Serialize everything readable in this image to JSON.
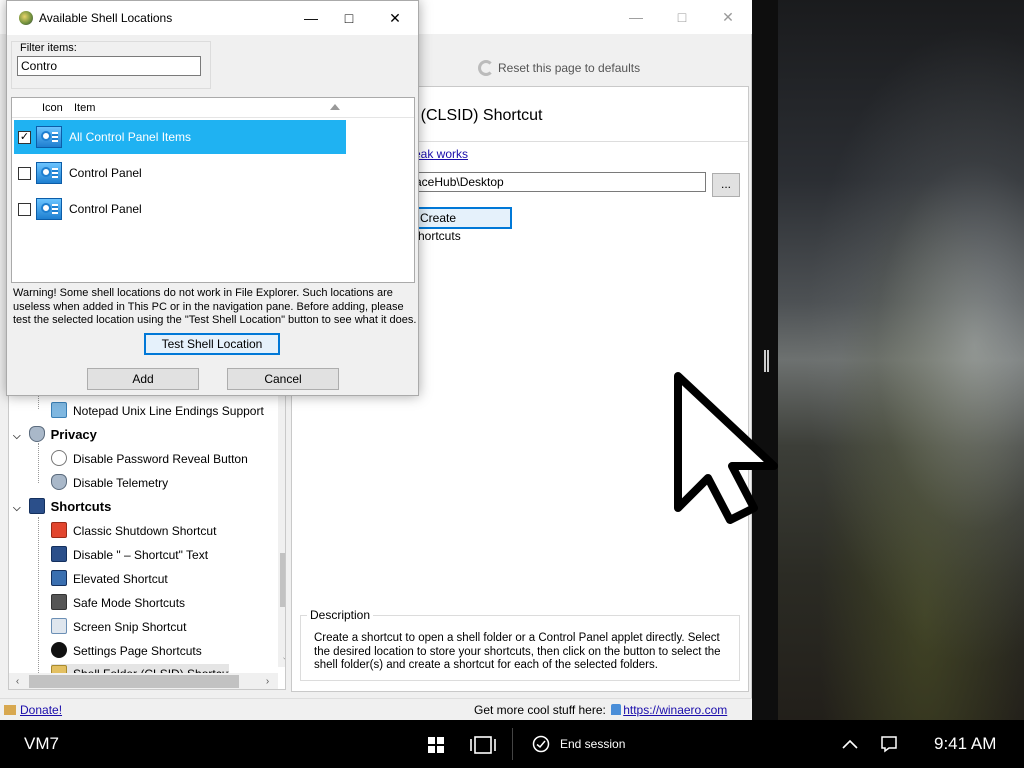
{
  "dialog": {
    "title": "Available Shell Locations",
    "filter_label": "Filter items:",
    "filter_value": "Contro",
    "columns": {
      "icon": "Icon",
      "item": "Item"
    },
    "items": [
      {
        "label": "All Control Panel Items",
        "checked": true,
        "selected": true
      },
      {
        "label": "Control Panel",
        "checked": false,
        "selected": false
      },
      {
        "label": "Control Panel",
        "checked": false,
        "selected": false
      }
    ],
    "warning": "Warning! Some shell locations do not work in File Explorer. Such locations are useless when added in This PC or in the navigation pane. Before adding, please test the selected location using the \"Test Shell Location\" button to see what it does.",
    "test_button": "Test Shell Location",
    "add_button": "Add",
    "cancel_button": "Cancel"
  },
  "main": {
    "reset_label": "Reset this page to defaults",
    "page_title": "er (CLSID) Shortcut",
    "link_text": "eak works",
    "path_value": "aceHub\\Desktop",
    "browse_label": "...",
    "create_button": "d Create Shortcuts",
    "description_legend": "Description",
    "description_text": "Create a shortcut to open a shell folder or a Control Panel applet directly. Select the desired location to store your shortcuts, then click on the button to select the shell folder(s) and create a shortcut for each of the selected folders."
  },
  "tree": {
    "items": [
      {
        "label": "Notepad Unix Line Endings Support",
        "type": "item",
        "icon": "notepad-icon"
      },
      {
        "label": "Privacy",
        "type": "category",
        "icon": "shield-icon"
      },
      {
        "label": "Disable Password Reveal Button",
        "type": "item",
        "icon": "eye-icon"
      },
      {
        "label": "Disable Telemetry",
        "type": "item",
        "icon": "shield-icon"
      },
      {
        "label": "Shortcuts",
        "type": "category",
        "icon": "shortcut-arrow-icon"
      },
      {
        "label": "Classic Shutdown Shortcut",
        "type": "item",
        "icon": "power-icon"
      },
      {
        "label": "Disable \" – Shortcut\" Text",
        "type": "item",
        "icon": "shortcut-arrow-icon"
      },
      {
        "label": "Elevated Shortcut",
        "type": "item",
        "icon": "shortcut-arrow-icon"
      },
      {
        "label": "Safe Mode Shortcuts",
        "type": "item",
        "icon": "monitor-icon"
      },
      {
        "label": "Screen Snip Shortcut",
        "type": "item",
        "icon": "scissors-icon"
      },
      {
        "label": "Settings Page Shortcuts",
        "type": "item",
        "icon": "gear-icon"
      },
      {
        "label": "Shell Folder (CLSID) Shortcut",
        "type": "item",
        "icon": "folder-icon"
      }
    ]
  },
  "statusbar": {
    "donate": "Donate!",
    "more_text": "Get more cool stuff here:",
    "more_link": "https://winaero.com"
  },
  "taskbar": {
    "vm_name": "VM7",
    "end_session": "End session",
    "time": "9:41 AM"
  }
}
